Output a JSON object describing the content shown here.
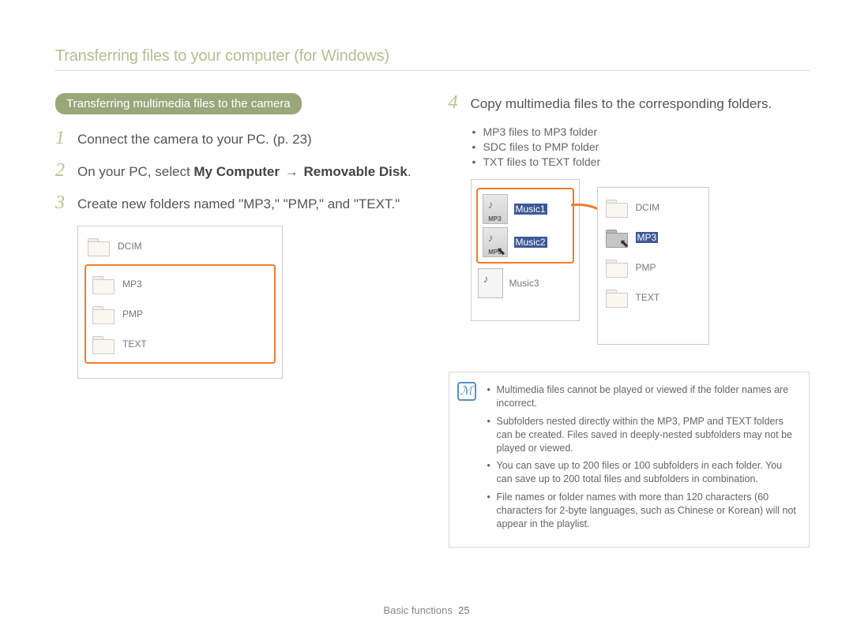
{
  "header": {
    "title": "Transferring files to your computer (for Windows)"
  },
  "section_pill": "Transferring multimedia files to the camera",
  "steps": {
    "s1": {
      "num": "1",
      "text": "Connect the camera to your PC. (p. 23)"
    },
    "s2": {
      "num": "2",
      "pre": "On your PC, select ",
      "b1": "My Computer",
      "arrow": "→",
      "b2": "Removable Disk",
      "post": "."
    },
    "s3": {
      "num": "3",
      "text": "Create new folders named \"MP3,\" \"PMP,\" and \"TEXT.\""
    },
    "s4": {
      "num": "4",
      "text": "Copy multimedia files to the corresponding folders."
    }
  },
  "bullets_right": [
    "MP3 files to MP3 folder",
    "SDC files to PMP folder",
    "TXT files to TEXT folder"
  ],
  "win_left": {
    "top": "DCIM",
    "items": [
      "MP3",
      "PMP",
      "TEXT"
    ]
  },
  "win_src": {
    "sel1": "Music1",
    "sel2": "Music2",
    "item3": "Music3"
  },
  "win_dst": {
    "items": [
      "DCIM",
      "MP3",
      "PMP",
      "TEXT"
    ]
  },
  "notes": [
    "Multimedia files cannot be played or viewed if the folder names are incorrect.",
    "Subfolders nested directly within the MP3, PMP and TEXT folders can be created. Files saved in deeply-nested subfolders may not be played or viewed.",
    "You can save up to 200 files or 100 subfolders in each folder. You can save up to 200 total files and subfolders in combination.",
    "File names or folder names with more than 120 characters (60 characters for 2-byte languages, such as Chinese or Korean) will not appear in the playlist."
  ],
  "footer": {
    "section": "Basic functions",
    "page": "25"
  }
}
